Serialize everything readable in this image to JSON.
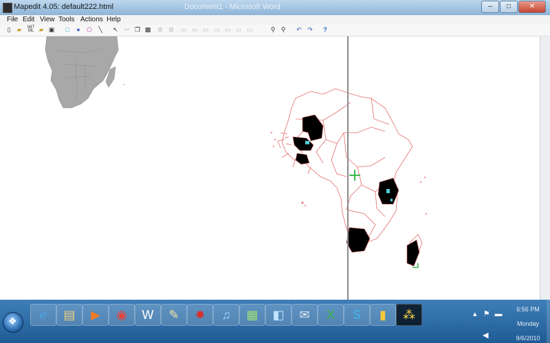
{
  "window": {
    "title": "Mapedit 4.05: default222.html",
    "background_title": "Document1 - Microsoft Word",
    "minimize": "–",
    "maximize": "□",
    "close": "✕"
  },
  "menu": [
    "File",
    "Edit",
    "View",
    "Tools",
    "Actions",
    "Help"
  ],
  "toolbar": {
    "buttons": [
      "new-icon",
      "open-icon",
      "img-html-icon",
      "open-file-icon",
      "save-icon",
      "rect-icon",
      "circle-icon",
      "polygon-icon",
      "line-icon",
      "pointer-icon",
      "cut-icon",
      "copy-icon",
      "paste-icon",
      "grid-icon",
      "zoom-in-icon",
      "zoom-out-icon",
      "undo-icon",
      "redo-icon",
      "help-icon"
    ]
  },
  "colors": {
    "country_border": "#e46a6a",
    "land_gray": "#a8a8a8",
    "region_fill": "#000000",
    "crosshair": "#3cb84a",
    "taskbar": "#2a6fa8"
  },
  "taskbar": {
    "start": "start-orb",
    "apps": [
      "internet-explorer",
      "file-explorer",
      "media-player",
      "chrome",
      "word-doc",
      "notepad",
      "paint-splash",
      "itunes",
      "picture-viewer",
      "dvd",
      "outlook",
      "excel",
      "skype",
      "usb-device",
      "mapedit"
    ],
    "tray_icons": [
      "flag-icon",
      "network-icon",
      "volume-icon"
    ],
    "time": "6:56 PM",
    "day": "Monday",
    "date": "9/6/2010"
  }
}
